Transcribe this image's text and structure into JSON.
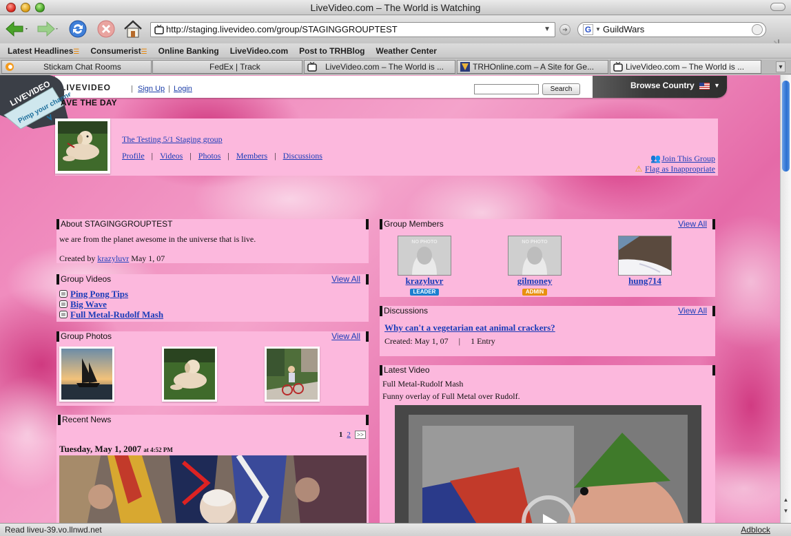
{
  "window": {
    "title": "LiveVideo.com – The World is Watching"
  },
  "toolbar": {
    "url": "http://staging.livevideo.com/group/STAGINGGROUPTEST",
    "search_value": "GuildWars"
  },
  "bookmarks": [
    "Latest Headlines",
    "Consumerist",
    "Online Banking",
    "LiveVideo.com",
    "Post to TRHBlog",
    "Weather Center"
  ],
  "tabs": [
    {
      "label": "Stickam Chat Rooms"
    },
    {
      "label": "FedEx | Track"
    },
    {
      "label": "LiveVideo.com – The World is ..."
    },
    {
      "label": "TRHOnline.com – A Site for Ge..."
    },
    {
      "label": "LiveVideo.com – The World is ..."
    }
  ],
  "site": {
    "logo": "LIVEVIDEO",
    "signup": "Sign Up",
    "login": "Login",
    "search_button": "Search",
    "browse_country": "Browse Country",
    "banner": "AVE THE DAY",
    "badge_line1": "LIVEVIDEO",
    "badge_line2": "Pimp your channel"
  },
  "group": {
    "title": "The Testing 5/1 Staging group",
    "nav": [
      "Profile",
      "Videos",
      "Photos",
      "Members",
      "Discussions"
    ],
    "join": "Join This Group",
    "flag": "Flag as Inappropriate"
  },
  "about": {
    "title": "About STAGINGGROUPTEST",
    "description": "we are from the planet awesome in the universe that is live.",
    "created_by_label": "Created by",
    "created_by_user": "krazyluvr",
    "created_date": "May 1, 07"
  },
  "videos": {
    "title": "Group Videos",
    "view_all": "View All",
    "items": [
      "Ping Pong Tips",
      "Big Wave",
      "Full Metal-Rudolf Mash"
    ]
  },
  "photos": {
    "title": "Group Photos",
    "view_all": "View All"
  },
  "news": {
    "title": "Recent News",
    "page_current": "1",
    "page_next": "2",
    "page_more": ">>",
    "date": "Tuesday, May 1, 2007",
    "time": "at 4:52 PM"
  },
  "members": {
    "title": "Group Members",
    "view_all": "View All",
    "items": [
      {
        "name": "krazyluvr",
        "badge": "LEADER",
        "badge_color": "#1a7fd0"
      },
      {
        "name": "gilmoney",
        "badge": "ADMIN",
        "badge_color": "#e8900e"
      },
      {
        "name": "hung714",
        "badge": "",
        "badge_color": ""
      }
    ],
    "no_photo": "NO PHOTO"
  },
  "discussions": {
    "title": "Discussions",
    "view_all": "View All",
    "topic": "Why can't a vegetarian eat animal crackers?",
    "created": "Created: May 1, 07",
    "entries": "1 Entry"
  },
  "latest_video": {
    "title": "Latest Video",
    "name": "Full Metal-Rudolf Mash",
    "description": "Funny overlay of Full Metal over Rudolf."
  },
  "status": {
    "text": "Read liveu-39.vo.llnwd.net",
    "adblock": "Adblock"
  }
}
